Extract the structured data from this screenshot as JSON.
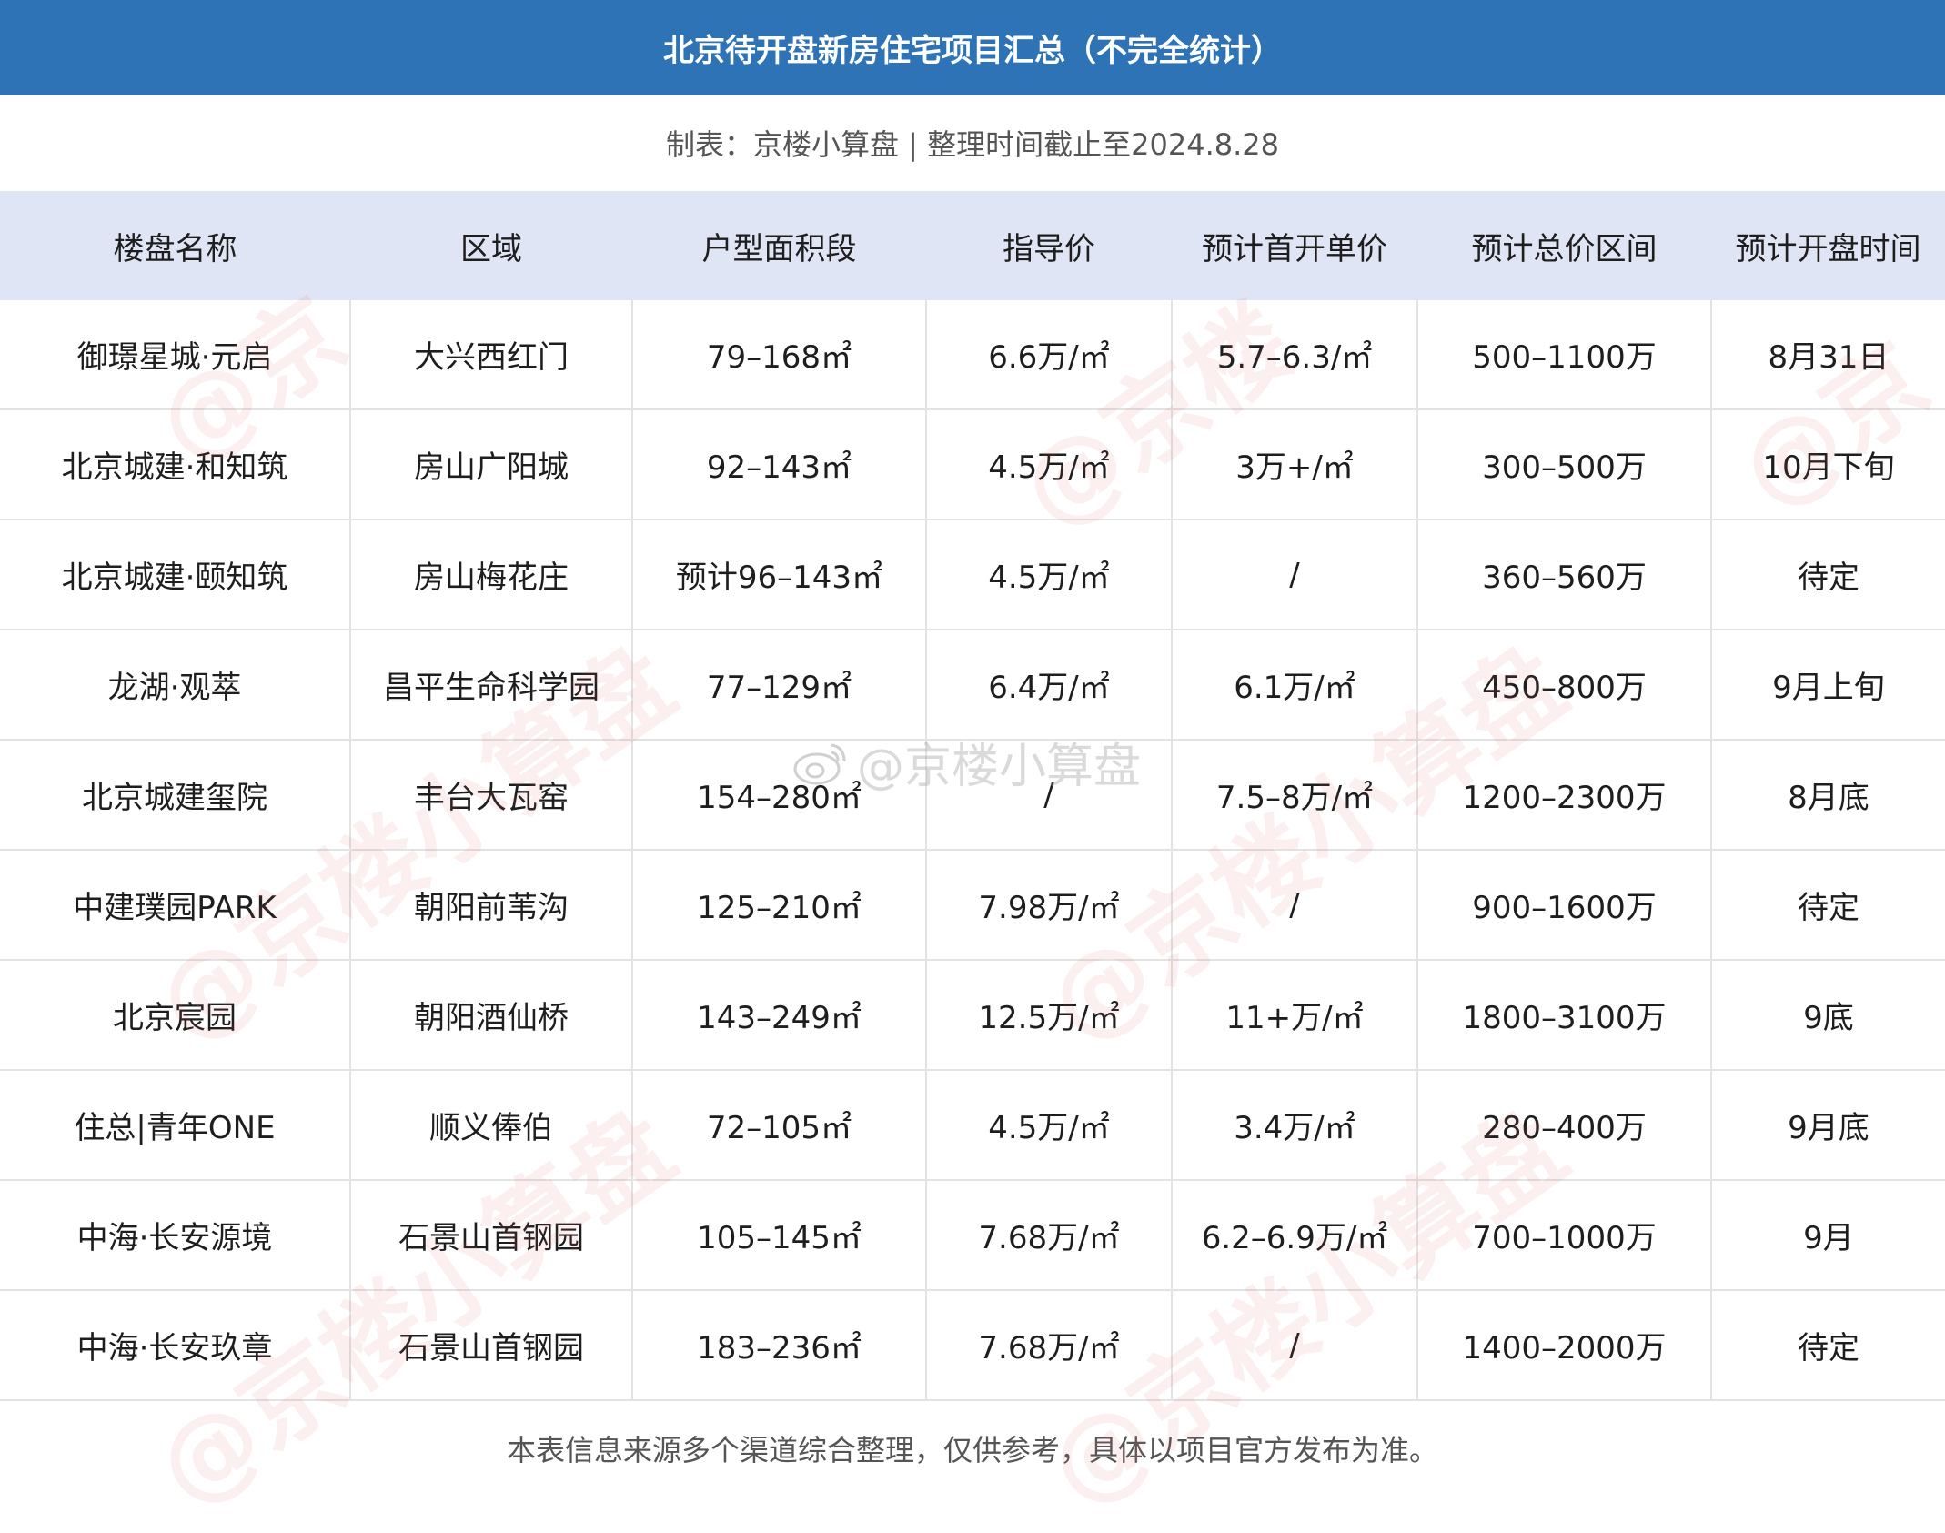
{
  "title": "北京待开盘新房住宅项目汇总（不完全统计）",
  "subtitle": "制表：京楼小算盘 | 整理时间截止至2024.8.28",
  "headers": [
    "楼盘名称",
    "区域",
    "户型面积段",
    "指导价",
    "预计首开单价",
    "预计总价区间",
    "预计开盘时间"
  ],
  "rows": [
    [
      "御璟星城·元启",
      "大兴西红门",
      "79–168㎡",
      "6.6万/㎡",
      "5.7–6.3/㎡",
      "500–1100万",
      "8月31日"
    ],
    [
      "北京城建·和知筑",
      "房山广阳城",
      "92–143㎡",
      "4.5万/㎡",
      "3万+/㎡",
      "300–500万",
      "10月下旬"
    ],
    [
      "北京城建·颐知筑",
      "房山梅花庄",
      "预计96–143㎡",
      "4.5万/㎡",
      "/",
      "360–560万",
      "待定"
    ],
    [
      "龙湖·观萃",
      "昌平生命科学园",
      "77–129㎡",
      "6.4万/㎡",
      "6.1万/㎡",
      "450–800万",
      "9月上旬"
    ],
    [
      "北京城建玺院",
      "丰台大瓦窑",
      "154–280㎡",
      "/",
      "7.5–8万/㎡",
      "1200–2300万",
      "8月底"
    ],
    [
      "中建璞园PARK",
      "朝阳前苇沟",
      "125–210㎡",
      "7.98万/㎡",
      "/",
      "900–1600万",
      "待定"
    ],
    [
      "北京宸园",
      "朝阳酒仙桥",
      "143–249㎡",
      "12.5万/㎡",
      "11+万/㎡",
      "1800–3100万",
      "9底"
    ],
    [
      "住总|青年ONE",
      "顺义俸伯",
      "72–105㎡",
      "4.5万/㎡",
      "3.4万/㎡",
      "280–400万",
      "9月底"
    ],
    [
      "中海·长安源境",
      "石景山首钢园",
      "105–145㎡",
      "7.68万/㎡",
      "6.2–6.9万/㎡",
      "700–1000万",
      "9月"
    ],
    [
      "中海·长安玖章",
      "石景山首钢园",
      "183–236㎡",
      "7.68万/㎡",
      "/",
      "1400–2000万",
      "待定"
    ]
  ],
  "footer": "本表信息来源多个渠道综合整理，仅供参考，具体以项目官方发布为准。",
  "watermark": "@京楼小算盘",
  "colors": {
    "header_bar": "#2f73b7",
    "column_header_bg": "#dfe5f4"
  }
}
